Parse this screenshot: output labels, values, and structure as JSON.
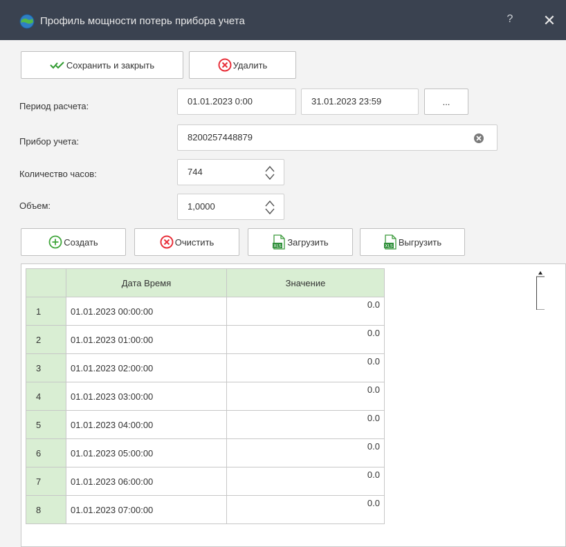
{
  "window": {
    "title": "Профиль мощности потерь прибора учета",
    "help_label": "?",
    "close_label": "✕"
  },
  "toolbar": {
    "save_label": "Сохранить и закрыть",
    "delete_label": "Удалить"
  },
  "form": {
    "period_label": "Период расчета:",
    "period_start": "01.01.2023 0:00",
    "period_end": "31.01.2023 23:59",
    "period_button_label": "...",
    "meter_label": "Прибор учета:",
    "meter_value": "8200257448879",
    "hours_label": "Количество часов:",
    "hours_value": "744",
    "volume_label": "Объем:",
    "volume_value": "1,0000"
  },
  "grid_toolbar": {
    "create_label": "Создать",
    "clear_label": "Очистить",
    "load_label": "Загрузить",
    "export_label": "Выгрузить"
  },
  "table": {
    "headers": [
      "",
      "Дата Время",
      "Значение"
    ],
    "rows": [
      {
        "n": "1",
        "datetime": "01.01.2023 00:00:00",
        "value": "0.0"
      },
      {
        "n": "2",
        "datetime": "01.01.2023 01:00:00",
        "value": "0.0"
      },
      {
        "n": "3",
        "datetime": "01.01.2023 02:00:00",
        "value": "0.0"
      },
      {
        "n": "4",
        "datetime": "01.01.2023 03:00:00",
        "value": "0.0"
      },
      {
        "n": "5",
        "datetime": "01.01.2023 04:00:00",
        "value": "0.0"
      },
      {
        "n": "6",
        "datetime": "01.01.2023 05:00:00",
        "value": "0.0"
      },
      {
        "n": "7",
        "datetime": "01.01.2023 06:00:00",
        "value": "0.0"
      },
      {
        "n": "8",
        "datetime": "01.01.2023 07:00:00",
        "value": "0.0"
      }
    ]
  },
  "colors": {
    "titlebar": "#3a4250",
    "header_green": "#d9eed3",
    "delete_red": "#e8303a",
    "create_green": "#3fa53a",
    "check_green": "#2f9a2f"
  },
  "icons": {
    "app": "globe-icon",
    "save": "check-icon",
    "delete": "delete-circle-icon",
    "create": "plus-circle-icon",
    "clear": "clear-circle-icon",
    "load": "xls-file-icon",
    "export": "xls-file-icon",
    "meter_clear": "clear-field-icon",
    "spin": "spinner-arrows-icon"
  }
}
